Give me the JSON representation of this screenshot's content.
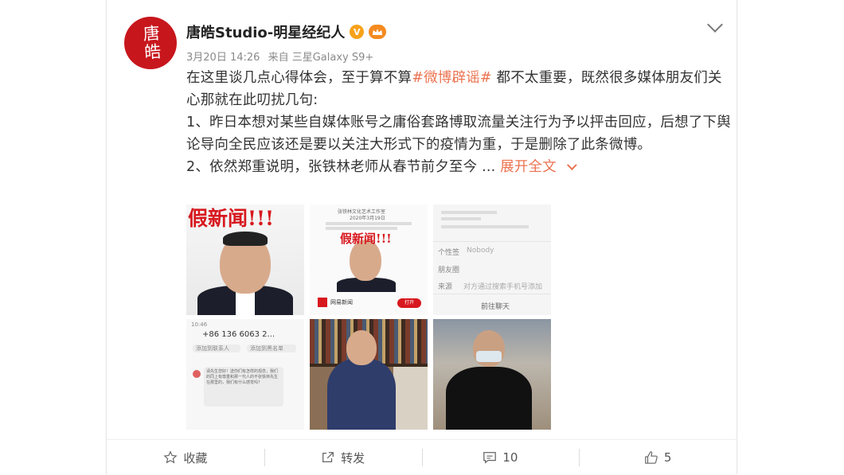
{
  "post": {
    "author": "唐皓Studio-明星经纪人",
    "avatar_text": "唐皓",
    "verified_icon": "V",
    "crown_icon": "crown",
    "date": "3月20日 14:26",
    "source": "来自 三星Galaxy S9+",
    "line1_pre": "在这里谈几点心得体会，至于算不算",
    "hashtag": "#微博辟谣#",
    "line1_post": " 都不太重要，既然很多媒体朋友们关心那就在此叨扰几句:",
    "para2": "1、昨日本想对某些自媒体账号之庸俗套路博取流量关注行为予以抨击回应，后想了下舆论导向全民应该还是要以关注大形式下的疫情为重，于是删除了此条微博。",
    "para3": "2、依然郑重说明，张铁林老师从春节前夕至今 ...",
    "expand_label": "展开全文"
  },
  "images": {
    "img1_text": "假新闻!!!",
    "img2_header": "张铁林文化艺术工作室",
    "img2_date": "2020年3月19日",
    "img2_text": "假新闻!!!",
    "img2_brand": "网易新闻",
    "img2_button": "打开",
    "img3_label1": "个性签",
    "img3_value1": "Nobody",
    "img3_label2": "朋友圈",
    "img3_label3": "来源",
    "img3_value3": "对方通过搜索手机号添加",
    "img3_button": "前往聊天",
    "img4_time": "10:46",
    "img4_number": "+86 136 6063 2...",
    "img4_btn1": "添加到联系人",
    "img4_btn2": "添加到黑名单",
    "img4_msg": "请先生您好！送你们有怎样的观念，我们的同上有尊重和那一代人的不张铁林先生在那里的，我们有什么感觉吗？"
  },
  "footer": {
    "favorite_label": "收藏",
    "forward_label": "转发",
    "comment_count": "10",
    "like_count": "5"
  }
}
